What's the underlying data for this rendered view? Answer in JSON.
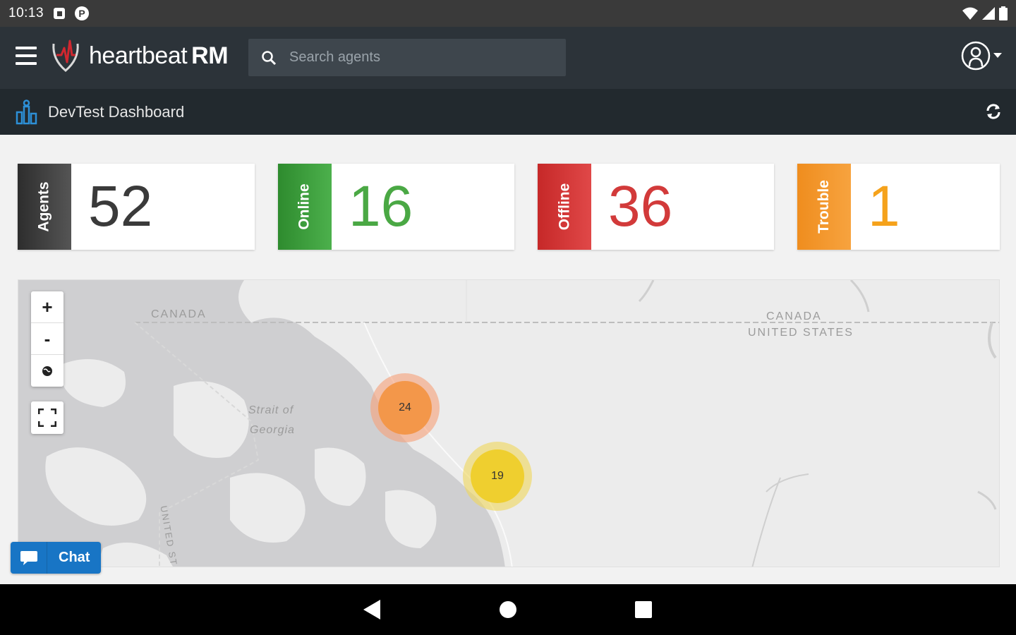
{
  "statusbar": {
    "time": "10:13"
  },
  "app": {
    "brand_light": "heartbeat",
    "brand_bold": "RM",
    "search_placeholder": "Search agents"
  },
  "subheader": {
    "title": "DevTest Dashboard"
  },
  "stats": [
    {
      "label": "Agents",
      "value": "52",
      "color": "#3a3a3a"
    },
    {
      "label": "Online",
      "value": "16",
      "color": "#4aa844"
    },
    {
      "label": "Offline",
      "value": "36",
      "color": "#d23a3a"
    },
    {
      "label": "Trouble",
      "value": "1",
      "color": "#f5a21b"
    }
  ],
  "map": {
    "labels": {
      "canada_west": "CANADA",
      "canada_east": "CANADA",
      "united_states_east": "UNITED STATES",
      "strait_line1": "Strait of",
      "strait_line2": "Georgia",
      "united_states_south": "UNITED ST"
    },
    "zoom_in": "+",
    "zoom_out": "-",
    "clusters": [
      {
        "count": "24",
        "color": "#f3974a"
      },
      {
        "count": "19",
        "color": "#efcf2f"
      }
    ]
  },
  "chat": {
    "label": "Chat"
  }
}
